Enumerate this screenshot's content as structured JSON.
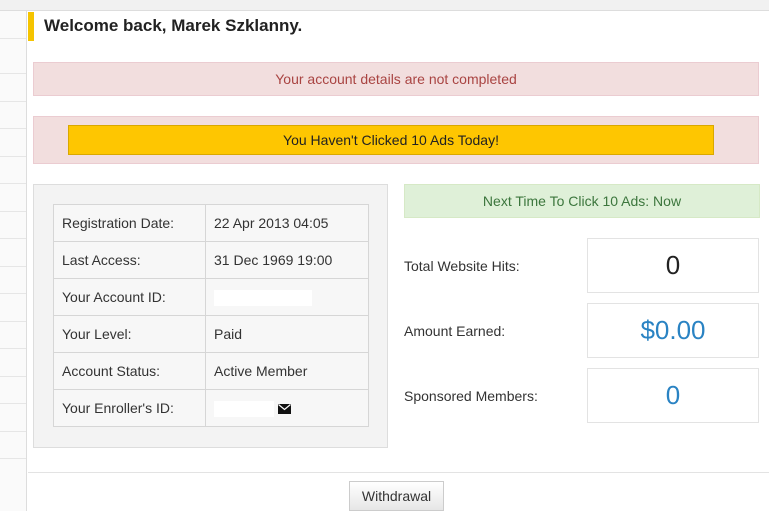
{
  "header": {
    "title": "Welcome back, Marek Szklanny."
  },
  "alerts": {
    "account_incomplete": "Your account details are not completed",
    "clicked_ads_button": "You Haven't Clicked 10 Ads Today!",
    "next_click": "Next Time To Click 10 Ads: Now"
  },
  "account_info": {
    "rows": [
      {
        "label": "Registration Date:",
        "value": "22 Apr 2013 04:05"
      },
      {
        "label": "Last Access:",
        "value": "31 Dec 1969 19:00"
      },
      {
        "label": "Your Account ID:",
        "value": ""
      },
      {
        "label": "Your Level:",
        "value": "Paid"
      },
      {
        "label": "Account Status:",
        "value": "Active Member"
      },
      {
        "label": "Your Enroller's ID:",
        "value": ""
      }
    ]
  },
  "stats": {
    "hits_label": "Total Website Hits:",
    "hits_value": "0",
    "earned_label": "Amount Earned:",
    "earned_value": "$0.00",
    "sponsored_label": "Sponsored Members:",
    "sponsored_value": "0"
  },
  "footer": {
    "withdrawal_label": "Withdrawal"
  },
  "icons": {
    "enroller_message": "envelope-icon"
  },
  "colors": {
    "accent_yellow": "#fec601",
    "stat_blue": "#2a83c3",
    "danger_text": "#a94442",
    "success_text": "#3c763d"
  }
}
